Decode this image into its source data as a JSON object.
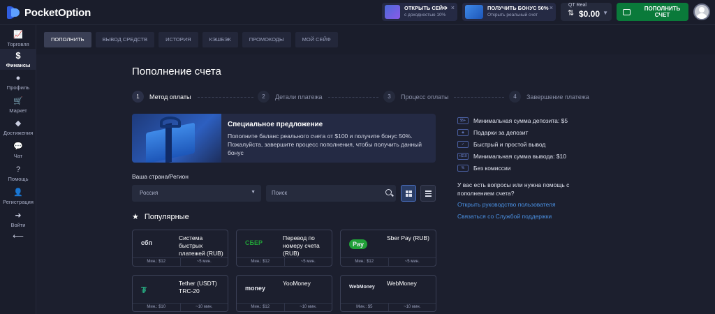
{
  "brand": {
    "name": "PocketOption"
  },
  "promos": [
    {
      "title": "ОТКРЫТЬ СЕЙФ",
      "subtitle": "с доходностью 10%"
    },
    {
      "title": "ПОЛУЧИТЬ БОНУС 50%",
      "subtitle": "Открыть реальный счет"
    }
  ],
  "account": {
    "label": "QT Real",
    "balance": "$0.00"
  },
  "deposit_button": "ПОПОЛНИТЬ СЧЕТ",
  "sidebar": {
    "items": [
      {
        "label": "Торговля",
        "icon": "chart-icon"
      },
      {
        "label": "Финансы",
        "icon": "dollar-icon"
      },
      {
        "label": "Профиль",
        "icon": "user-icon"
      },
      {
        "label": "Маркет",
        "icon": "cart-icon"
      },
      {
        "label": "Достижения",
        "icon": "diamond-icon"
      },
      {
        "label": "Чат",
        "icon": "chat-icon"
      },
      {
        "label": "Помощь",
        "icon": "help-icon"
      },
      {
        "label": "Регистрация",
        "icon": "user-plus-icon"
      },
      {
        "label": "Войти",
        "icon": "login-icon"
      }
    ],
    "collapse_glyph": "⟵"
  },
  "tabs": [
    "ПОПОЛНИТЬ",
    "ВЫВОД СРЕДСТВ",
    "ИСТОРИЯ",
    "КЭШБЭК",
    "ПРОМОКОДЫ",
    "МОЙ СЕЙФ"
  ],
  "page": {
    "title": "Пополнение счета"
  },
  "steps": [
    {
      "num": "1",
      "label": "Метод оплаты"
    },
    {
      "num": "2",
      "label": "Детали платежа"
    },
    {
      "num": "3",
      "label": "Процесс оплаты"
    },
    {
      "num": "4",
      "label": "Завершение платежа"
    }
  ],
  "offer": {
    "title": "Специальное предложение",
    "text": "Пополните баланс реального счета от $100 и получите бонус 50%. Пожалуйста, завершите процесс пополнения, чтобы получить данный бонус"
  },
  "benefits": [
    {
      "icon_text": "$5+",
      "text": "Минимальная сумма депозита: $5"
    },
    {
      "icon_text": "◈",
      "text": "Подарки за депозит"
    },
    {
      "icon_text": "✓",
      "text": "Быстрый и простой вывод"
    },
    {
      "icon_text": "+$10",
      "text": "Минимальная сумма вывода: $10"
    },
    {
      "icon_text": "%",
      "text": "Без комиссии"
    }
  ],
  "help": {
    "question": "У вас есть вопросы или нужна помощь с пополнением счета?",
    "links": [
      "Открыть руководство пользователя",
      "Связаться со Службой поддержки"
    ]
  },
  "filters": {
    "country_label": "Ваша страна/Регион",
    "country_value": "Россия",
    "search_placeholder": "Поиск"
  },
  "popular_label": "Популярные",
  "methods": [
    {
      "logo": "сбп",
      "logo_color": "#ffffff",
      "name": "Система быстрых платежей (RUB)",
      "min": "Мин.: $12",
      "time": "~5 мин."
    },
    {
      "logo": "СБЕР",
      "logo_color": "#21a038",
      "name": "Перевод по номеру счета (RUB)",
      "min": "Мин.: $12",
      "time": "~5 мин."
    },
    {
      "logo": "Pay",
      "logo_color": "#ffffff",
      "name": "Sber Pay (RUB)",
      "min": "Мин.: $12",
      "time": "~5 мин."
    },
    {
      "logo": "₮",
      "logo_color": "#26a17b",
      "name": "Tether (USDT) TRC-20",
      "min": "Мин.: $10",
      "time": "~10 мин."
    },
    {
      "logo": "money",
      "logo_color": "#ffffff",
      "name": "YooMoney",
      "min": "Мин.: $12",
      "time": "~10 мин."
    },
    {
      "logo": "WebMoney",
      "logo_color": "#ffffff",
      "name": "WebMoney",
      "min": "Мин.: $5",
      "time": "~10 мин."
    }
  ]
}
